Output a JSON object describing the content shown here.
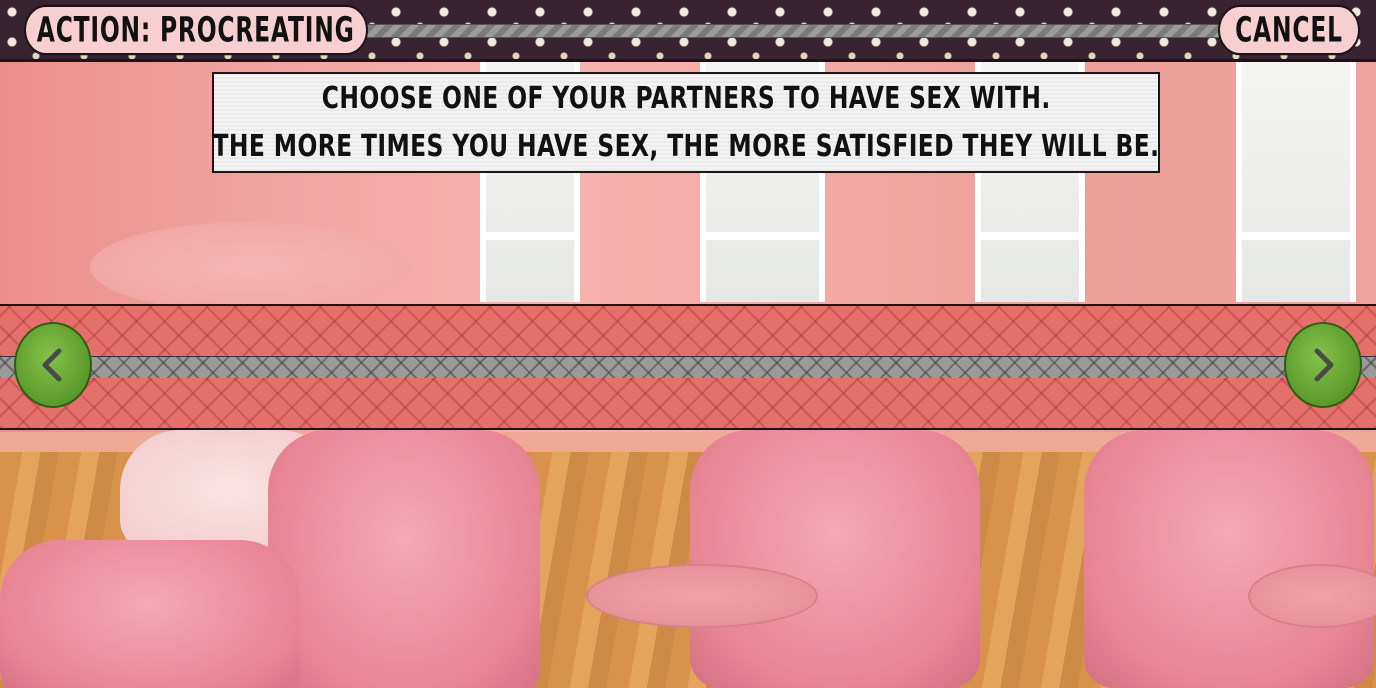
{
  "header": {
    "action_label": "ACTION: PROCREATING",
    "cancel_label": "CANCEL"
  },
  "instruction": {
    "line1": "CHOOSE ONE OF YOUR PARTNERS TO HAVE SEX WITH.",
    "line2": "THE MORE TIMES YOU HAVE SEX, THE MORE SATISFIED THEY WILL BE."
  },
  "selector": {
    "prev_icon": "chevron-left-icon",
    "next_icon": "chevron-right-icon"
  },
  "colors": {
    "pill": "#f7cfd0",
    "band": "#e5706b",
    "arrow_button": "#6fae3a"
  }
}
